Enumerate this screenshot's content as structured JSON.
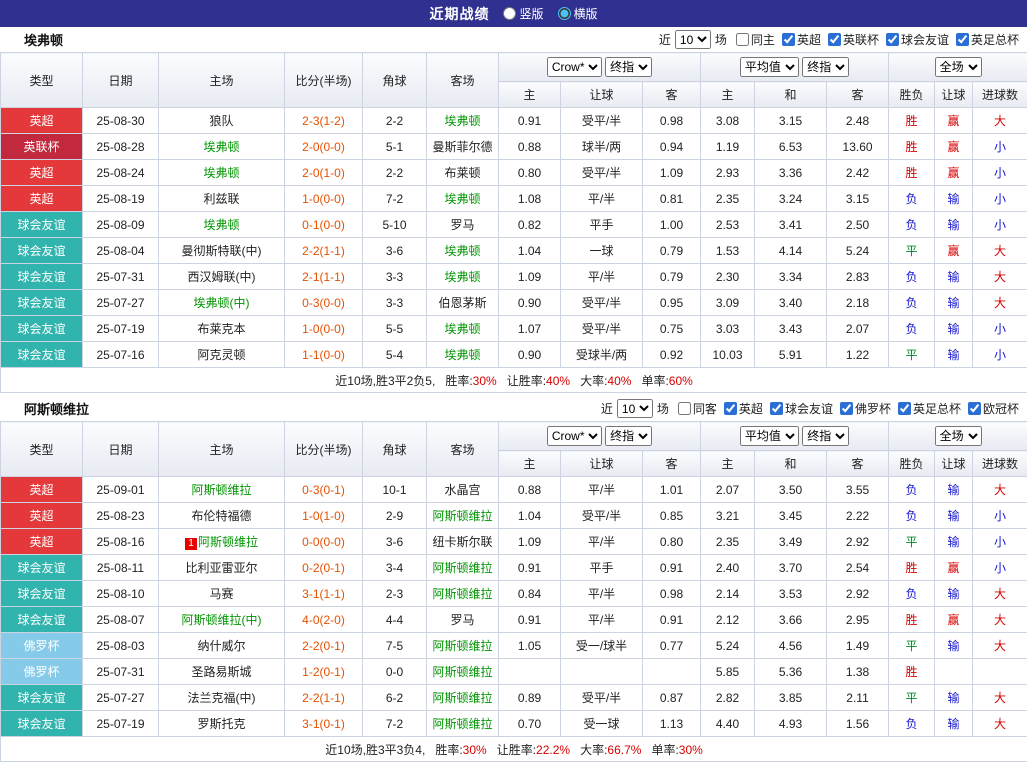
{
  "topbar": {
    "title": "近期战绩",
    "radios": [
      {
        "label": "竖版",
        "selected": false
      },
      {
        "label": "横版",
        "selected": true
      }
    ]
  },
  "colors": {
    "topbar_bg": "#2f3090",
    "team_highlight": "#009500",
    "score": "#e65100",
    "stat_value": "#d60000",
    "result_map": {
      "胜": "#d60000",
      "赢": "#d60000",
      "大": "#d60000",
      "负": "#1616d0",
      "输": "#1616d0",
      "小": "#1616d0",
      "平": "#00892c"
    }
  },
  "league_colors": {
    "英超": "#e5383b",
    "英联杯": "#c2293e",
    "球会友谊": "#30b4ad",
    "佛罗杯": "#85cbe9"
  },
  "columns": {
    "type": "类型",
    "date": "日期",
    "home": "主场",
    "score": "比分(半场)",
    "corner": "角球",
    "away": "客场",
    "bookmaker": "Crow*",
    "stage": "终指",
    "avg": "平均值",
    "stage2": "终指",
    "scope": "全场",
    "sub": [
      "主",
      "让球",
      "客",
      "主",
      "和",
      "客",
      "胜负",
      "让球",
      "进球数"
    ]
  },
  "sections": [
    {
      "team": "埃弗顿",
      "filter": {
        "near_label": "近",
        "count": "10",
        "games_label": "场",
        "checkboxes": [
          {
            "label": "同主",
            "checked": false
          },
          {
            "label": "英超",
            "checked": true
          },
          {
            "label": "英联杯",
            "checked": true
          },
          {
            "label": "球会友谊",
            "checked": true
          },
          {
            "label": "英足总杯",
            "checked": true
          }
        ]
      },
      "rows": [
        {
          "type": "英超",
          "date": "25-08-30",
          "home": "狼队",
          "score": "2-3(1-2)",
          "corner": "2-2",
          "away": "埃弗顿",
          "away_hl": true,
          "o1": "0.91",
          "o2": "受平/半",
          "o3": "0.98",
          "a1": "3.08",
          "a2": "3.15",
          "a3": "2.48",
          "r1": "胜",
          "r2": "赢",
          "r3": "大"
        },
        {
          "type": "英联杯",
          "date": "25-08-28",
          "home": "埃弗顿",
          "home_hl": true,
          "score": "2-0(0-0)",
          "corner": "5-1",
          "away": "曼斯菲尔德",
          "o1": "0.88",
          "o2": "球半/两",
          "o3": "0.94",
          "a1": "1.19",
          "a2": "6.53",
          "a3": "13.60",
          "r1": "胜",
          "r2": "赢",
          "r3": "小"
        },
        {
          "type": "英超",
          "date": "25-08-24",
          "home": "埃弗顿",
          "home_hl": true,
          "score": "2-0(1-0)",
          "corner": "2-2",
          "away": "布莱顿",
          "o1": "0.80",
          "o2": "受平/半",
          "o3": "1.09",
          "a1": "2.93",
          "a2": "3.36",
          "a3": "2.42",
          "r1": "胜",
          "r2": "赢",
          "r3": "小"
        },
        {
          "type": "英超",
          "date": "25-08-19",
          "home": "利兹联",
          "score": "1-0(0-0)",
          "corner": "7-2",
          "away": "埃弗顿",
          "away_hl": true,
          "o1": "1.08",
          "o2": "平/半",
          "o3": "0.81",
          "a1": "2.35",
          "a2": "3.24",
          "a3": "3.15",
          "r1": "负",
          "r2": "输",
          "r3": "小"
        },
        {
          "type": "球会友谊",
          "date": "25-08-09",
          "home": "埃弗顿",
          "home_hl": true,
          "score": "0-1(0-0)",
          "corner": "5-10",
          "away": "罗马",
          "o1": "0.82",
          "o2": "平手",
          "o3": "1.00",
          "a1": "2.53",
          "a2": "3.41",
          "a3": "2.50",
          "r1": "负",
          "r2": "输",
          "r3": "小"
        },
        {
          "type": "球会友谊",
          "date": "25-08-04",
          "home": "曼彻斯特联(中)",
          "score": "2-2(1-1)",
          "corner": "3-6",
          "away": "埃弗顿",
          "away_hl": true,
          "o1": "1.04",
          "o2": "一球",
          "o3": "0.79",
          "a1": "1.53",
          "a2": "4.14",
          "a3": "5.24",
          "r1": "平",
          "r2": "赢",
          "r3": "大"
        },
        {
          "type": "球会友谊",
          "date": "25-07-31",
          "home": "西汉姆联(中)",
          "score": "2-1(1-1)",
          "corner": "3-3",
          "away": "埃弗顿",
          "away_hl": true,
          "o1": "1.09",
          "o2": "平/半",
          "o3": "0.79",
          "a1": "2.30",
          "a2": "3.34",
          "a3": "2.83",
          "r1": "负",
          "r2": "输",
          "r3": "大"
        },
        {
          "type": "球会友谊",
          "date": "25-07-27",
          "home": "埃弗顿(中)",
          "home_hl": true,
          "score": "0-3(0-0)",
          "corner": "3-3",
          "away": "伯恩茅斯",
          "o1": "0.90",
          "o2": "受平/半",
          "o3": "0.95",
          "a1": "3.09",
          "a2": "3.40",
          "a3": "2.18",
          "r1": "负",
          "r2": "输",
          "r3": "大"
        },
        {
          "type": "球会友谊",
          "date": "25-07-19",
          "home": "布莱克本",
          "score": "1-0(0-0)",
          "corner": "5-5",
          "away": "埃弗顿",
          "away_hl": true,
          "o1": "1.07",
          "o2": "受平/半",
          "o3": "0.75",
          "a1": "3.03",
          "a2": "3.43",
          "a3": "2.07",
          "r1": "负",
          "r2": "输",
          "r3": "小"
        },
        {
          "type": "球会友谊",
          "date": "25-07-16",
          "home": "阿克灵顿",
          "score": "1-1(0-0)",
          "corner": "5-4",
          "away": "埃弗顿",
          "away_hl": true,
          "o1": "0.90",
          "o2": "受球半/两",
          "o3": "0.92",
          "a1": "10.03",
          "a2": "5.91",
          "a3": "1.22",
          "r1": "平",
          "r2": "输",
          "r3": "小"
        }
      ],
      "summary": {
        "prefix": "近10场,胜3平2负5,",
        "stats": [
          {
            "label": "胜率:",
            "value": "30%"
          },
          {
            "label": "让胜率:",
            "value": "40%"
          },
          {
            "label": "大率:",
            "value": "40%"
          },
          {
            "label": "单率:",
            "value": "60%"
          }
        ]
      }
    },
    {
      "team": "阿斯顿维拉",
      "filter": {
        "near_label": "近",
        "count": "10",
        "games_label": "场",
        "checkboxes": [
          {
            "label": "同客",
            "checked": false
          },
          {
            "label": "英超",
            "checked": true
          },
          {
            "label": "球会友谊",
            "checked": true
          },
          {
            "label": "佛罗杯",
            "checked": true
          },
          {
            "label": "英足总杯",
            "checked": true
          },
          {
            "label": "欧冠杯",
            "checked": true
          }
        ]
      },
      "rows": [
        {
          "type": "英超",
          "date": "25-09-01",
          "home": "阿斯顿维拉",
          "home_hl": true,
          "score": "0-3(0-1)",
          "corner": "10-1",
          "away": "水晶宫",
          "o1": "0.88",
          "o2": "平/半",
          "o3": "1.01",
          "a1": "2.07",
          "a2": "3.50",
          "a3": "3.55",
          "r1": "负",
          "r2": "输",
          "r3": "大"
        },
        {
          "type": "英超",
          "date": "25-08-23",
          "home": "布伦特福德",
          "score": "1-0(1-0)",
          "corner": "2-9",
          "away": "阿斯顿维拉",
          "away_hl": true,
          "o1": "1.04",
          "o2": "受平/半",
          "o3": "0.85",
          "a1": "3.21",
          "a2": "3.45",
          "a3": "2.22",
          "r1": "负",
          "r2": "输",
          "r3": "小"
        },
        {
          "type": "英超",
          "date": "25-08-16",
          "home": "阿斯顿维拉",
          "home_hl": true,
          "home_badge": "1",
          "score": "0-0(0-0)",
          "corner": "3-6",
          "away": "纽卡斯尔联",
          "o1": "1.09",
          "o2": "平/半",
          "o3": "0.80",
          "a1": "2.35",
          "a2": "3.49",
          "a3": "2.92",
          "r1": "平",
          "r2": "输",
          "r3": "小"
        },
        {
          "type": "球会友谊",
          "date": "25-08-11",
          "home": "比利亚雷亚尔",
          "score": "0-2(0-1)",
          "corner": "3-4",
          "away": "阿斯顿维拉",
          "away_hl": true,
          "o1": "0.91",
          "o2": "平手",
          "o3": "0.91",
          "a1": "2.40",
          "a2": "3.70",
          "a3": "2.54",
          "r1": "胜",
          "r2": "赢",
          "r3": "小"
        },
        {
          "type": "球会友谊",
          "date": "25-08-10",
          "home": "马赛",
          "score": "3-1(1-1)",
          "corner": "2-3",
          "away": "阿斯顿维拉",
          "away_hl": true,
          "o1": "0.84",
          "o2": "平/半",
          "o3": "0.98",
          "a1": "2.14",
          "a2": "3.53",
          "a3": "2.92",
          "r1": "负",
          "r2": "输",
          "r3": "大"
        },
        {
          "type": "球会友谊",
          "date": "25-08-07",
          "home": "阿斯顿维拉(中)",
          "home_hl": true,
          "score": "4-0(2-0)",
          "corner": "4-4",
          "away": "罗马",
          "o1": "0.91",
          "o2": "平/半",
          "o3": "0.91",
          "a1": "2.12",
          "a2": "3.66",
          "a3": "2.95",
          "r1": "胜",
          "r2": "赢",
          "r3": "大"
        },
        {
          "type": "佛罗杯",
          "date": "25-08-03",
          "home": "纳什威尔",
          "score": "2-2(0-1)",
          "corner": "7-5",
          "away": "阿斯顿维拉",
          "away_hl": true,
          "o1": "1.05",
          "o2": "受一/球半",
          "o3": "0.77",
          "a1": "5.24",
          "a2": "4.56",
          "a3": "1.49",
          "r1": "平",
          "r2": "输",
          "r3": "大"
        },
        {
          "type": "佛罗杯",
          "date": "25-07-31",
          "home": "圣路易斯城",
          "score": "1-2(0-1)",
          "corner": "0-0",
          "away": "阿斯顿维拉",
          "away_hl": true,
          "o1": "",
          "o2": "",
          "o3": "",
          "a1": "5.85",
          "a2": "5.36",
          "a3": "1.38",
          "r1": "胜",
          "r2": "",
          "r3": ""
        },
        {
          "type": "球会友谊",
          "date": "25-07-27",
          "home": "法兰克福(中)",
          "score": "2-2(1-1)",
          "corner": "6-2",
          "away": "阿斯顿维拉",
          "away_hl": true,
          "o1": "0.89",
          "o2": "受平/半",
          "o3": "0.87",
          "a1": "2.82",
          "a2": "3.85",
          "a3": "2.11",
          "r1": "平",
          "r2": "输",
          "r3": "大"
        },
        {
          "type": "球会友谊",
          "date": "25-07-19",
          "home": "罗斯托克",
          "score": "3-1(0-1)",
          "corner": "7-2",
          "away": "阿斯顿维拉",
          "away_hl": true,
          "o1": "0.70",
          "o2": "受一球",
          "o3": "1.13",
          "a1": "4.40",
          "a2": "4.93",
          "a3": "1.56",
          "r1": "负",
          "r2": "输",
          "r3": "大"
        }
      ],
      "summary": {
        "prefix": "近10场,胜3平3负4,",
        "stats": [
          {
            "label": "胜率:",
            "value": "30%"
          },
          {
            "label": "让胜率:",
            "value": "22.2%"
          },
          {
            "label": "大率:",
            "value": "66.7%"
          },
          {
            "label": "单率:",
            "value": "30%"
          }
        ]
      }
    }
  ]
}
